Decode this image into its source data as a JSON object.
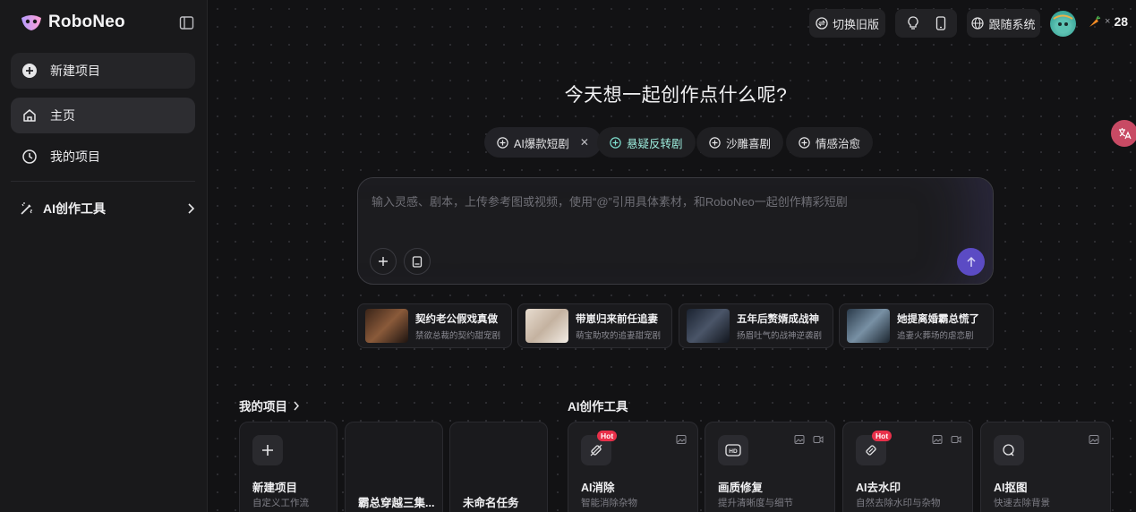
{
  "app": {
    "name": "RoboNeo"
  },
  "sidebar": {
    "items": [
      {
        "label": "新建项目",
        "icon": "plus-circle-icon"
      },
      {
        "label": "主页",
        "icon": "home-icon"
      },
      {
        "label": "我的项目",
        "icon": "clock-icon"
      }
    ],
    "tools_label": "AI创作工具"
  },
  "topbar": {
    "switch_label": "切换旧版",
    "language_label": "跟随系统",
    "credits_x": "×",
    "credits": "28"
  },
  "main": {
    "heading": "今天想一起创作点什么呢?",
    "chips": [
      {
        "label": "AI爆款短剧",
        "closable": true
      },
      {
        "label": "悬疑反转剧"
      },
      {
        "label": "沙雕喜剧"
      },
      {
        "label": "情感治愈"
      }
    ],
    "prompt_placeholder": "输入灵感、剧本，上传参考图或视频，使用“@”引用具体素材，和RoboNeo一起创作精彩短剧",
    "templates": [
      {
        "title": "契约老公假戏真做",
        "subtitle": "禁欲总裁的契约甜宠剧"
      },
      {
        "title": "带崽归来前任追妻",
        "subtitle": "萌宝助攻的追妻甜宠剧"
      },
      {
        "title": "五年后赘婿成战神",
        "subtitle": "扬眉吐气的战神逆袭剧"
      },
      {
        "title": "她提离婚霸总慌了",
        "subtitle": "追妻火葬场的虐恋剧"
      }
    ],
    "projects_title": "我的项目",
    "projects": [
      {
        "title": "新建项目",
        "subtitle": "自定义工作流"
      },
      {
        "title": "霸总穿越三集..."
      },
      {
        "title": "未命名任务"
      }
    ],
    "tools_title": "AI创作工具",
    "tools": [
      {
        "title": "AI消除",
        "subtitle": "智能消除杂物",
        "badge": "Hot"
      },
      {
        "title": "画质修复",
        "subtitle": "提升清晰度与细节"
      },
      {
        "title": "AI去水印",
        "subtitle": "自然去除水印与杂物",
        "badge": "Hot"
      },
      {
        "title": "AI抠图",
        "subtitle": "快速去除背景"
      }
    ]
  },
  "colors": {
    "accent": "#5b4bc4",
    "hot_badge": "#e8304a",
    "background": "#121214"
  }
}
